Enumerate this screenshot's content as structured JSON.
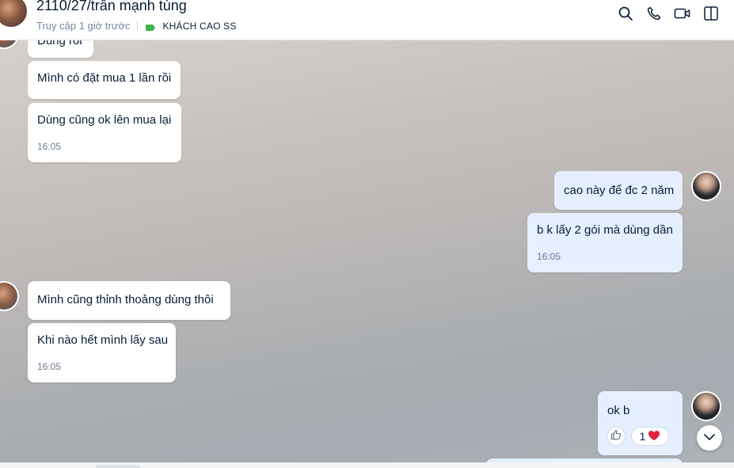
{
  "header": {
    "contact_name": "2110/27/trần mạnh tùng",
    "last_seen": "Truy cập 1 giờ trước",
    "tag_label": "KHÁCH CAO SS",
    "tag_color": "#3bb54a",
    "icons": [
      "search-icon",
      "phone-icon",
      "video-call-icon",
      "sidebar-toggle-icon"
    ]
  },
  "messages": {
    "m0": {
      "text": "Đúng rồi"
    },
    "m1": {
      "text": "Mình có đặt mua 1 lần rồi"
    },
    "m2": {
      "text": "Dùng cũng ok lên mua lại",
      "time": "16:05"
    },
    "m3": {
      "text": "cao này để đc 2 năm"
    },
    "m4": {
      "text": "b k lấy 2 gói mà dùng dần",
      "time": "16:05"
    },
    "m5": {
      "text": "Mình cũng thỉnh thoảng dùng thôi"
    },
    "m6": {
      "text": "Khi nào hết mình lấy sau",
      "time": "16:05"
    },
    "m7": {
      "text": "ok b",
      "reaction_count": "1",
      "reaction_icon": "heart-icon"
    }
  },
  "colors": {
    "incoming_bubble": "#ffffff",
    "outgoing_bubble": "#e5efff",
    "heart": "#e0243a"
  }
}
